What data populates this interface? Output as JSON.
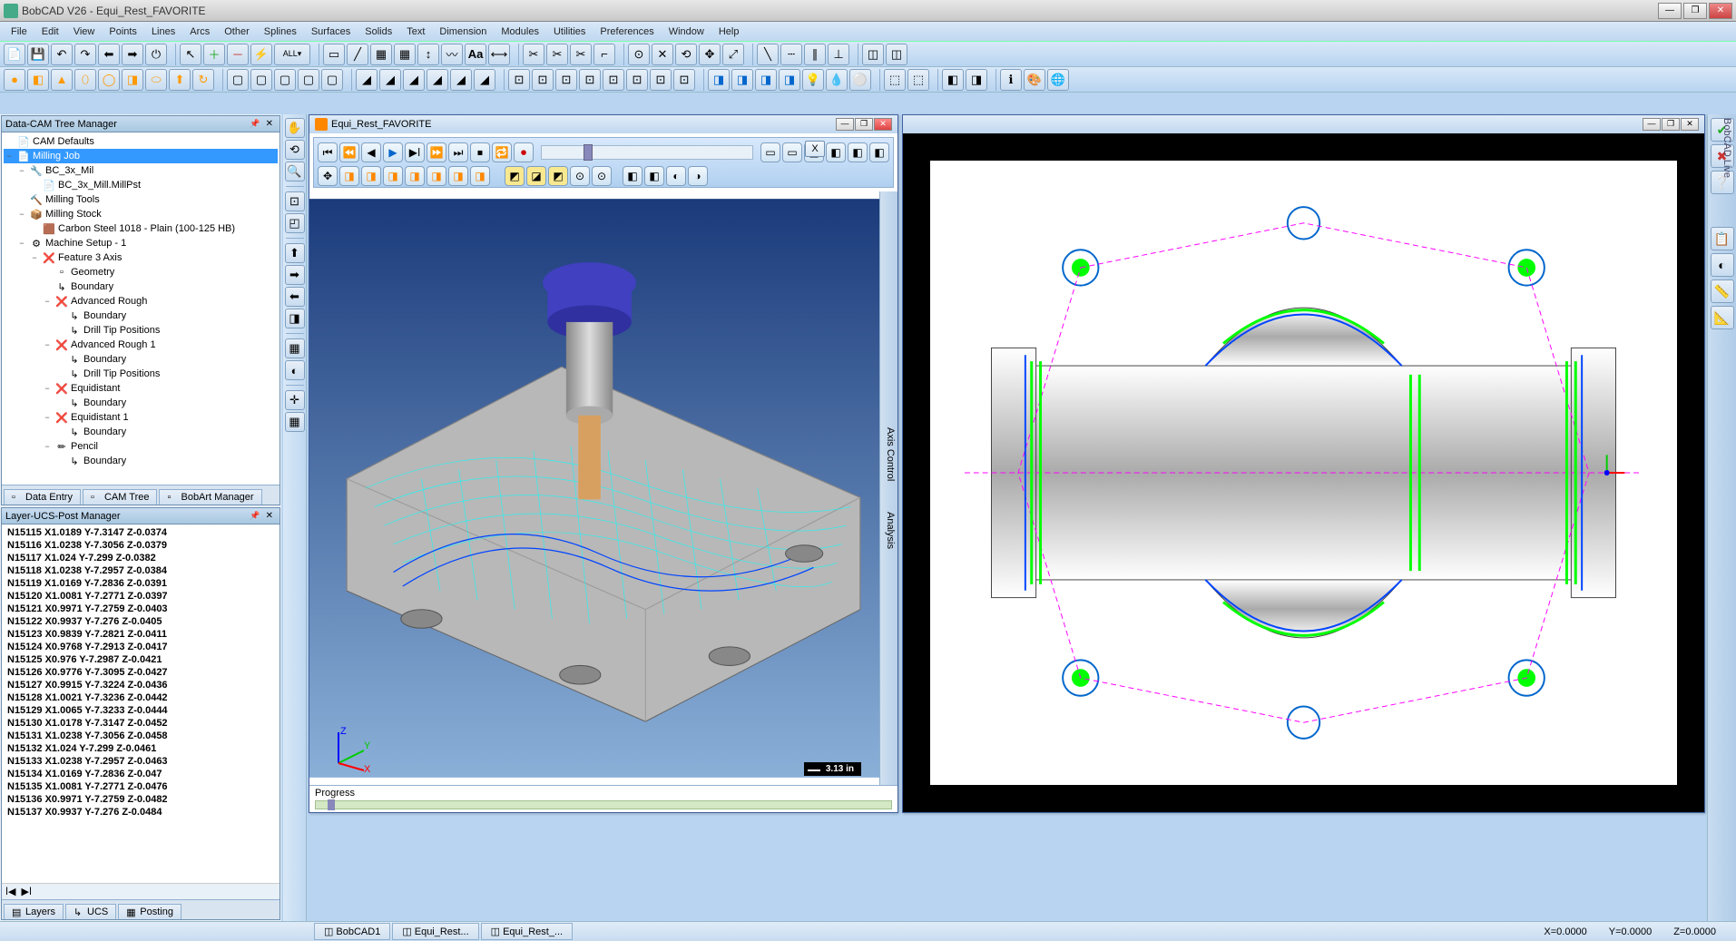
{
  "window": {
    "title": "BobCAD V26 - Equi_Rest_FAVORITE"
  },
  "menu": [
    "File",
    "Edit",
    "View",
    "Points",
    "Lines",
    "Arcs",
    "Other",
    "Splines",
    "Surfaces",
    "Solids",
    "Text",
    "Dimension",
    "Modules",
    "Utilities",
    "Preferences",
    "Window",
    "Help"
  ],
  "left_panel_1": {
    "title": "Data-CAM Tree Manager",
    "tabs": [
      "Data Entry",
      "CAM Tree",
      "BobArt Manager"
    ]
  },
  "tree": [
    {
      "lvl": 0,
      "exp": "",
      "icon": "📄",
      "label": "CAM Defaults"
    },
    {
      "lvl": 0,
      "exp": "−",
      "icon": "📄",
      "label": "Milling Job",
      "sel": true
    },
    {
      "lvl": 1,
      "exp": "−",
      "icon": "🔧",
      "label": "BC_3x_Mil"
    },
    {
      "lvl": 2,
      "exp": "",
      "icon": "📄",
      "label": "BC_3x_Mill.MillPst"
    },
    {
      "lvl": 1,
      "exp": "",
      "icon": "🔨",
      "label": "Milling Tools"
    },
    {
      "lvl": 1,
      "exp": "−",
      "icon": "📦",
      "label": "Milling Stock"
    },
    {
      "lvl": 2,
      "exp": "",
      "icon": "🟫",
      "label": "Carbon Steel 1018 - Plain (100-125 HB)"
    },
    {
      "lvl": 1,
      "exp": "−",
      "icon": "⚙",
      "label": "Machine Setup - 1"
    },
    {
      "lvl": 2,
      "exp": "−",
      "icon": "❌",
      "label": "Feature 3 Axis"
    },
    {
      "lvl": 3,
      "exp": "",
      "icon": "▫",
      "label": "Geometry"
    },
    {
      "lvl": 3,
      "exp": "",
      "icon": "↳",
      "label": "Boundary"
    },
    {
      "lvl": 3,
      "exp": "−",
      "icon": "❌",
      "label": "Advanced Rough"
    },
    {
      "lvl": 4,
      "exp": "",
      "icon": "↳",
      "label": "Boundary"
    },
    {
      "lvl": 4,
      "exp": "",
      "icon": "↳",
      "label": "Drill Tip Positions"
    },
    {
      "lvl": 3,
      "exp": "−",
      "icon": "❌",
      "label": "Advanced Rough 1"
    },
    {
      "lvl": 4,
      "exp": "",
      "icon": "↳",
      "label": "Boundary"
    },
    {
      "lvl": 4,
      "exp": "",
      "icon": "↳",
      "label": "Drill Tip Positions"
    },
    {
      "lvl": 3,
      "exp": "−",
      "icon": "❌",
      "label": "Equidistant"
    },
    {
      "lvl": 4,
      "exp": "",
      "icon": "↳",
      "label": "Boundary"
    },
    {
      "lvl": 3,
      "exp": "−",
      "icon": "❌",
      "label": "Equidistant 1"
    },
    {
      "lvl": 4,
      "exp": "",
      "icon": "↳",
      "label": "Boundary"
    },
    {
      "lvl": 3,
      "exp": "−",
      "icon": "✏",
      "label": "Pencil"
    },
    {
      "lvl": 4,
      "exp": "",
      "icon": "↳",
      "label": "Boundary"
    }
  ],
  "left_panel_2": {
    "title": "Layer-UCS-Post Manager",
    "tabs": [
      "Layers",
      "UCS",
      "Posting"
    ]
  },
  "gcode": [
    "N15115 X1.0189 Y-7.3147 Z-0.0374",
    "N15116 X1.0238 Y-7.3056 Z-0.0379",
    "N15117 X1.024 Y-7.299 Z-0.0382",
    "N15118 X1.0238 Y-7.2957 Z-0.0384",
    "N15119 X1.0169 Y-7.2836 Z-0.0391",
    "N15120 X1.0081 Y-7.2771 Z-0.0397",
    "N15121 X0.9971 Y-7.2759 Z-0.0403",
    "N15122 X0.9937 Y-7.276 Z-0.0405",
    "N15123 X0.9839 Y-7.2821 Z-0.0411",
    "N15124 X0.9768 Y-7.2913 Z-0.0417",
    "N15125 X0.976 Y-7.2987 Z-0.0421",
    "N15126 X0.9776 Y-7.3095 Z-0.0427",
    "N15127 X0.9915 Y-7.3224 Z-0.0436",
    "N15128 X1.0021 Y-7.3236 Z-0.0442",
    "N15129 X1.0065 Y-7.3233 Z-0.0444",
    "N15130 X1.0178 Y-7.3147 Z-0.0452",
    "N15131 X1.0238 Y-7.3056 Z-0.0458",
    "N15132 X1.024 Y-7.299 Z-0.0461",
    "N15133 X1.0238 Y-7.2957 Z-0.0463",
    "N15134 X1.0169 Y-7.2836 Z-0.047",
    "N15135 X1.0081 Y-7.2771 Z-0.0476",
    "N15136 X0.9971 Y-7.2759 Z-0.0482",
    "N15137 X0.9937 Y-7.276 Z-0.0484"
  ],
  "viewport1": {
    "title": "Equi_Rest_FAVORITE",
    "axis_labels": [
      "Axis Control",
      "Analysis"
    ],
    "scale_label": "3.13 in",
    "progress_label": "Progress",
    "float_btn": "X"
  },
  "status": {
    "tabs": [
      "BobCAD1",
      "Equi_Rest...",
      "Equi_Rest_..."
    ],
    "x": "X=0.0000",
    "y": "Y=0.0000",
    "z": "Z=0.0000"
  },
  "right_label": "BobCAD Live"
}
